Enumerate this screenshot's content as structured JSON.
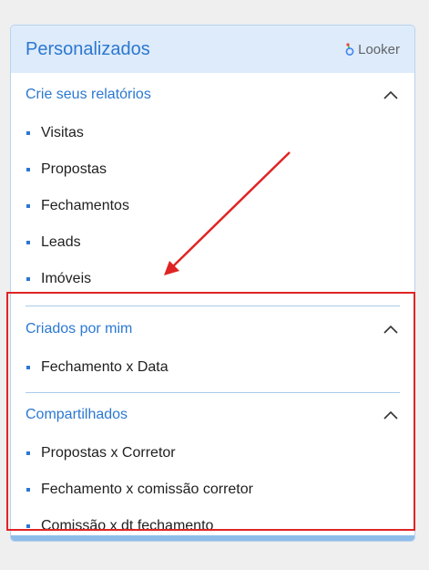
{
  "header": {
    "title": "Personalizados",
    "brand": "Looker",
    "brand_icon": "looker-logo-icon"
  },
  "sections": [
    {
      "title": "Crie seus relatórios",
      "items": [
        "Visitas",
        "Propostas",
        "Fechamentos",
        "Leads",
        "Imóveis"
      ]
    },
    {
      "title": "Criados por mim",
      "items": [
        "Fechamento x Data"
      ]
    },
    {
      "title": "Compartilhados",
      "items": [
        "Propostas x Corretor",
        "Fechamento x comissão corretor",
        "Comissão x dt fechamento"
      ]
    }
  ],
  "colors": {
    "accent": "#2b78d1",
    "header_bg": "#deebfa",
    "annotation": "#e02424"
  }
}
